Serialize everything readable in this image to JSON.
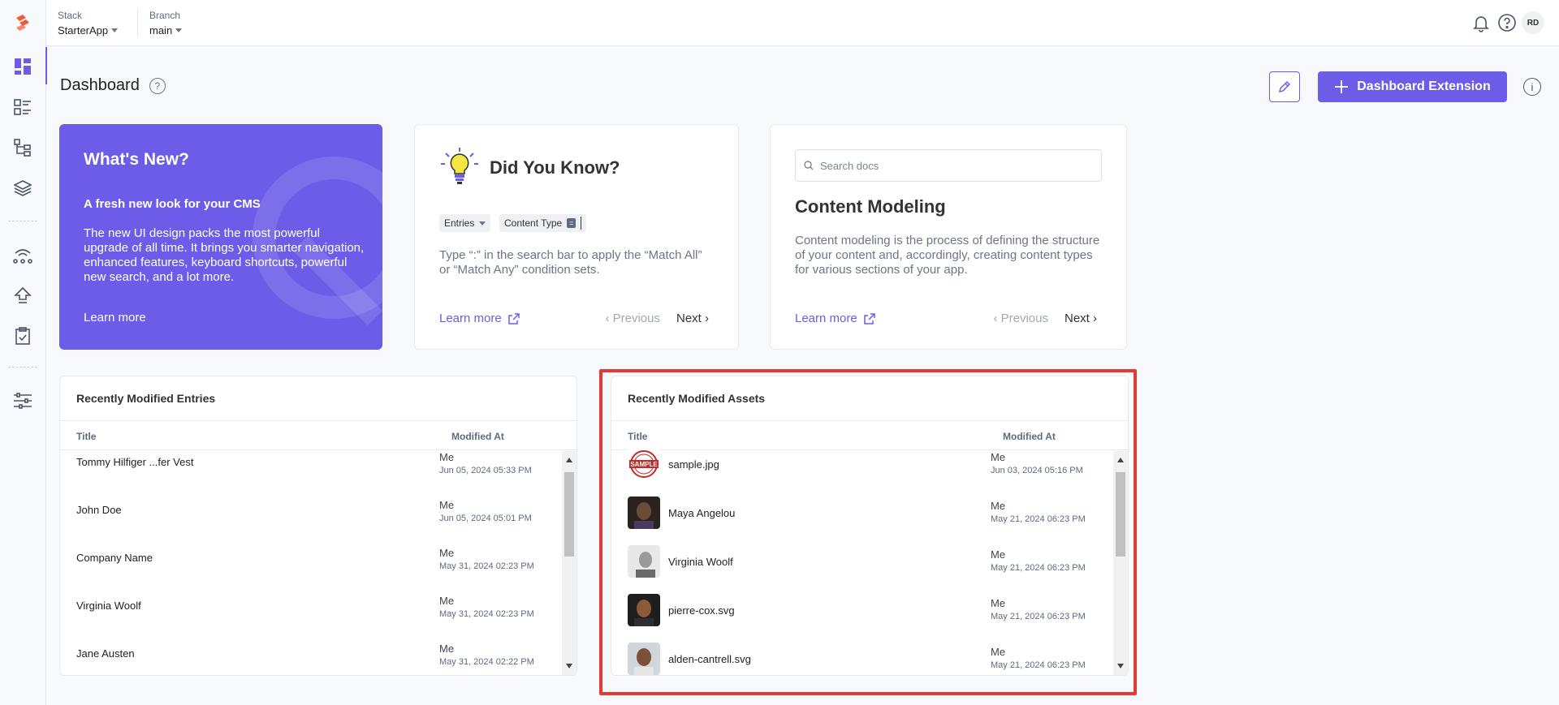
{
  "topbar": {
    "stack_label": "Stack",
    "stack_value": "StarterApp",
    "branch_label": "Branch",
    "branch_value": "main",
    "user_initials": "RD"
  },
  "header": {
    "title": "Dashboard",
    "help": "?",
    "extension_button": "Dashboard Extension",
    "info": "i"
  },
  "whats_new": {
    "title": "What's New?",
    "subtitle": "A fresh new look for your CMS",
    "body": "The new UI design packs the most powerful upgrade of all time. It brings you smarter navigation, enhanced features, keyboard shortcuts, powerful new search, and a lot more.",
    "link": "Learn more"
  },
  "did_you_know": {
    "title": "Did You Know?",
    "chip_entries": "Entries",
    "chip_content_type": "Content Type",
    "chip_eq": "=",
    "body": "Type “:” in the search bar to apply the “Match All” or “Match Any” condition sets.",
    "link": "Learn more",
    "previous": "Previous",
    "next": "Next"
  },
  "docs": {
    "search_placeholder": "Search docs",
    "title": "Content Modeling",
    "body": "Content modeling is the process of defining the structure of your content and, accordingly, creating content types for various sections of your app.",
    "link": "Learn more",
    "previous": "Previous",
    "next": "Next"
  },
  "entries": {
    "title": "Recently Modified Entries",
    "col_title": "Title",
    "col_modified": "Modified At",
    "rows": [
      {
        "title": "Tommy Hilfiger ...fer Vest",
        "by": "Me",
        "date": "Jun 05, 2024 05:33 PM"
      },
      {
        "title": "John Doe",
        "by": "Me",
        "date": "Jun 05, 2024 05:01 PM"
      },
      {
        "title": "Company Name",
        "by": "Me",
        "date": "May 31, 2024 02:23 PM"
      },
      {
        "title": "Virginia Woolf",
        "by": "Me",
        "date": "May 31, 2024 02:23 PM"
      },
      {
        "title": "Jane Austen",
        "by": "Me",
        "date": "May 31, 2024 02:22 PM"
      }
    ]
  },
  "assets": {
    "title": "Recently Modified Assets",
    "col_title": "Title",
    "col_modified": "Modified At",
    "rows": [
      {
        "title": "sample.jpg",
        "by": "Me",
        "date": "Jun 03, 2024 05:16 PM",
        "thumb_label": "SAMPLE"
      },
      {
        "title": "Maya Angelou",
        "by": "Me",
        "date": "May 21, 2024 06:23 PM"
      },
      {
        "title": "Virginia Woolf",
        "by": "Me",
        "date": "May 21, 2024 06:23 PM"
      },
      {
        "title": "pierre-cox.svg",
        "by": "Me",
        "date": "May 21, 2024 06:23 PM"
      },
      {
        "title": "alden-cantrell.svg",
        "by": "Me",
        "date": "May 21, 2024 06:23 PM"
      }
    ]
  },
  "colors": {
    "accent": "#6c5ce7",
    "highlight": "#e53935",
    "logo": "#f05a3c"
  },
  "icons": [
    "logo-icon",
    "dashboard-icon",
    "entries-icon",
    "content-models-icon",
    "assets-icon",
    "releases-icon",
    "deploy-icon",
    "workflow-icon",
    "settings-icon",
    "bell-icon",
    "help-icon",
    "pencil-icon",
    "plus-icon",
    "info-icon",
    "bulb-icon",
    "search-icon",
    "external-link-icon",
    "chevron-left-icon",
    "chevron-right-icon"
  ]
}
